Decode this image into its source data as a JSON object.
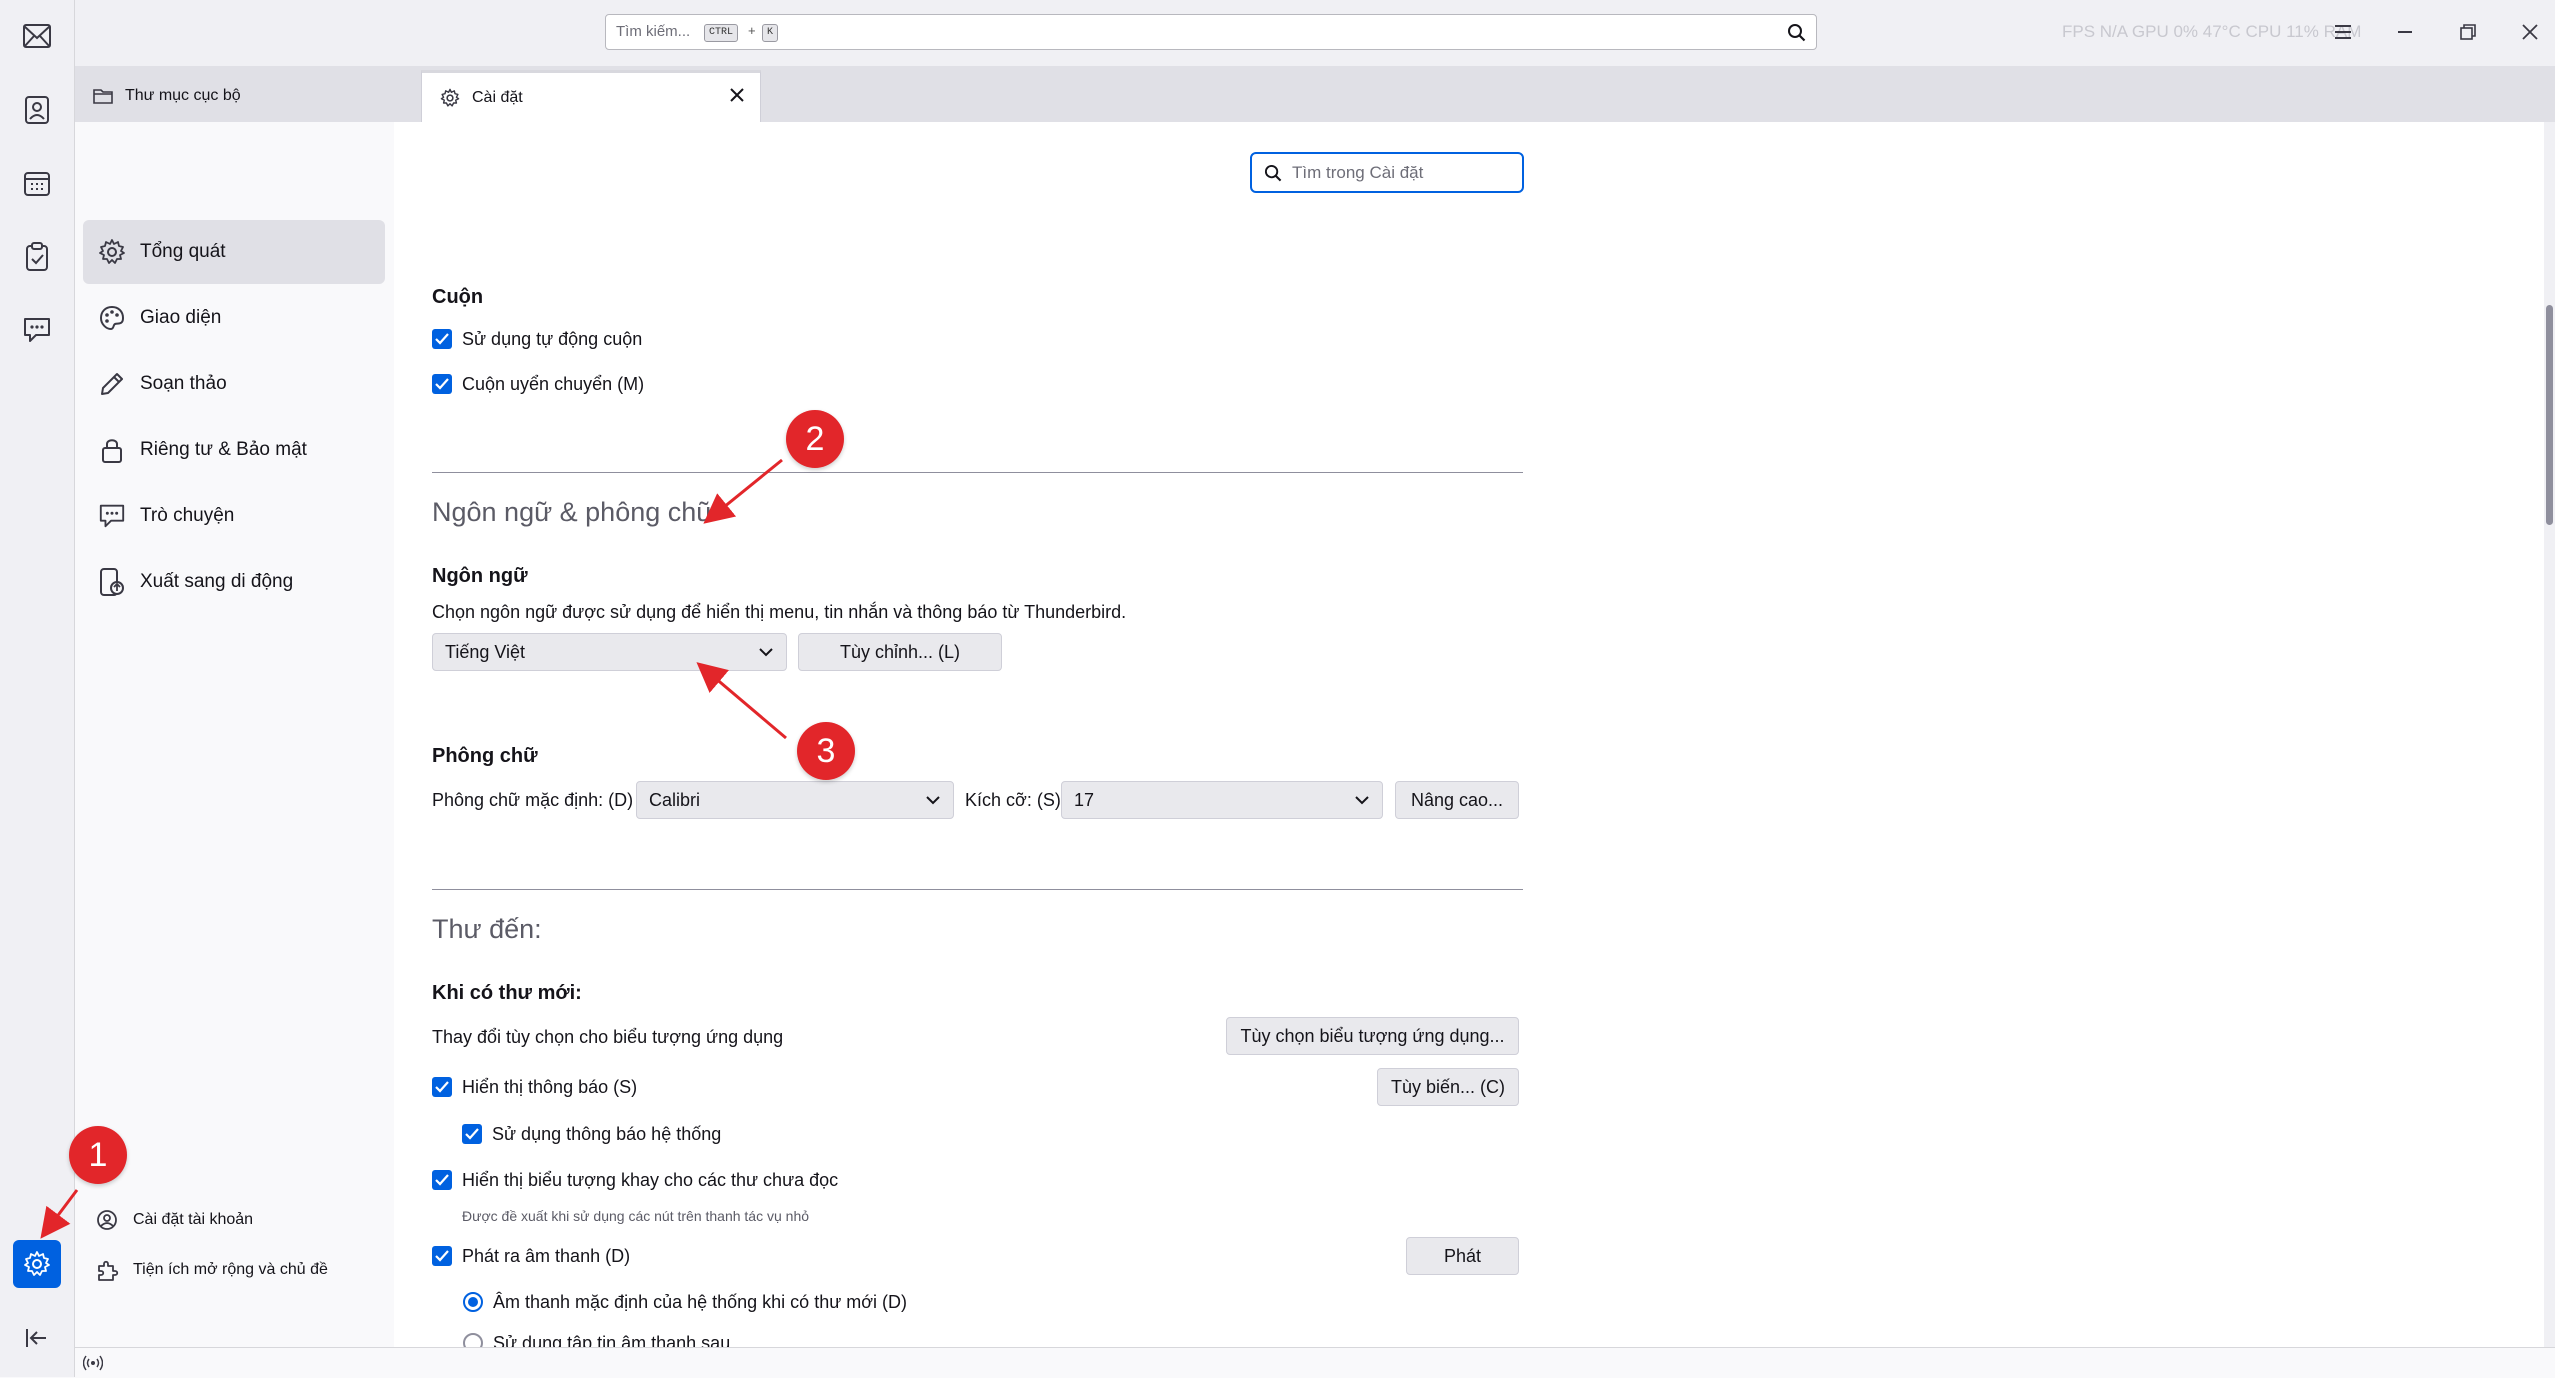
{
  "titlebar": {
    "search_placeholder": "Tìm kiếm...",
    "shortcut_key1": "CTRL",
    "shortcut_plus": "+",
    "shortcut_key2": "K",
    "perf_overlay": "FPS N/A   GPU 0% 47°C   CPU 11%   RAM"
  },
  "tabs": [
    {
      "label": "Thư mục cục bộ"
    },
    {
      "label": "Cài đặt"
    }
  ],
  "nav": {
    "items": [
      {
        "label": "Tổng quát"
      },
      {
        "label": "Giao diện"
      },
      {
        "label": "Soạn thảo"
      },
      {
        "label": "Riêng tư & Bảo mật"
      },
      {
        "label": "Trò chuyện"
      },
      {
        "label": "Xuất sang di động"
      }
    ],
    "footer": [
      {
        "label": "Cài đặt tài khoản"
      },
      {
        "label": "Tiện ích mở rộng và chủ đề"
      }
    ]
  },
  "settings_search": {
    "placeholder": "Tìm trong Cài đặt"
  },
  "scroll": {
    "title": "Cuộn",
    "autoscroll": "Sử dụng tự động cuộn",
    "smooth": "Cuộn uyển chuyển (M)"
  },
  "lang_font": {
    "section_title": "Ngôn ngữ & phông chữ",
    "lang_title": "Ngôn ngữ",
    "lang_desc": "Chọn ngôn ngữ được sử dụng để hiển thị menu, tin nhắn và thông báo từ Thunderbird.",
    "lang_value": "Tiếng Việt",
    "customize_button": "Tùy chỉnh... (L)",
    "font_title": "Phông chữ",
    "default_font_label": "Phông chữ mặc định: (D)",
    "default_font_value": "Calibri",
    "size_label": "Kích cỡ: (S)",
    "size_value": "17",
    "advanced_button": "Nâng cao..."
  },
  "incoming": {
    "section_title": "Thư đến:",
    "when_new": "Khi có thư mới:",
    "app_icon_desc": "Thay đổi tùy chọn cho biểu tượng ứng dụng",
    "app_icon_button": "Tùy chọn biểu tượng ứng dụng...",
    "show_alert": "Hiển thị thông báo (S)",
    "customize_alert_button": "Tùy biến... (C)",
    "use_system_notif": "Sử dụng thông báo hệ thống",
    "tray_icon": "Hiển thị biểu tượng khay cho các thư chưa đọc",
    "tray_hint": "Được đề xuất khi sử dụng các nút trên thanh tác vụ nhỏ",
    "play_sound": "Phát ra âm thanh (D)",
    "play_button": "Phát",
    "default_sound": "Âm thanh mặc định của hệ thống khi có thư mới (D)",
    "custom_sound": "Sử dụng tập tin âm thanh sau"
  },
  "annotations": [
    "1",
    "2",
    "3"
  ],
  "colors": {
    "accent": "#0061e0",
    "annotation": "#e2262a"
  }
}
